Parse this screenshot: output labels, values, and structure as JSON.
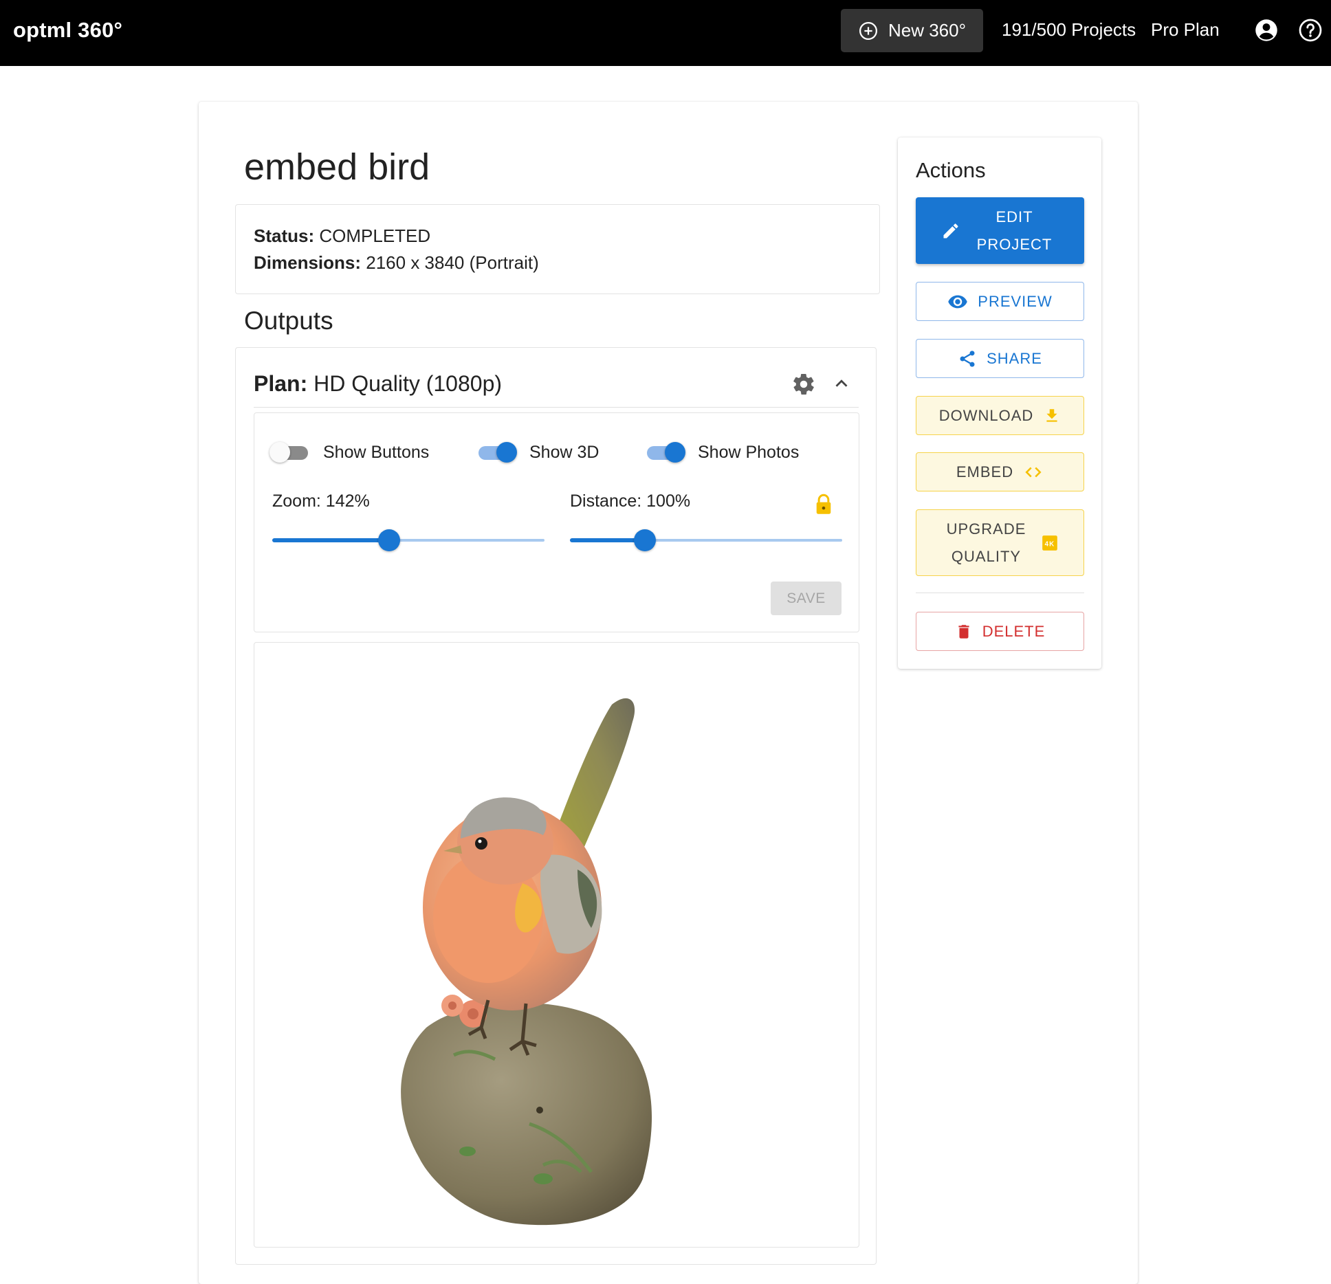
{
  "topbar": {
    "brand": "optml 360°",
    "new_button": "New 360°",
    "projects_count": "191/500 Projects",
    "plan": "Pro Plan",
    "icons": [
      "plus-circle-icon",
      "account-circle-icon",
      "help-circle-icon"
    ]
  },
  "project": {
    "title": "embed bird",
    "status_label": "Status:",
    "status_value": "COMPLETED",
    "dimensions_label": "Dimensions:",
    "dimensions_value": "2160 x 3840 (Portrait)"
  },
  "outputs": {
    "heading": "Outputs",
    "plan_label": "Plan:",
    "plan_value": "HD Quality (1080p)",
    "toggles": [
      {
        "label": "Show Buttons",
        "on": false
      },
      {
        "label": "Show 3D",
        "on": true
      },
      {
        "label": "Show Photos",
        "on": true
      }
    ],
    "zoom": {
      "label": "Zoom: 142%",
      "fraction": 0.43
    },
    "distance": {
      "label": "Distance: 100%",
      "fraction": 0.275
    },
    "save_label": "SAVE"
  },
  "actions": {
    "heading": "Actions",
    "edit_project": "EDIT PROJECT",
    "preview": "PREVIEW",
    "share": "SHARE",
    "download": "DOWNLOAD",
    "embed": "EMBED",
    "upgrade_quality": "UPGRADE QUALITY",
    "upgrade_badge": "4K",
    "delete": "DELETE"
  },
  "colors": {
    "primary": "#1976d2",
    "topbar": "#000000",
    "warning_yellow": "#f6c000",
    "danger": "#d32f2f"
  }
}
